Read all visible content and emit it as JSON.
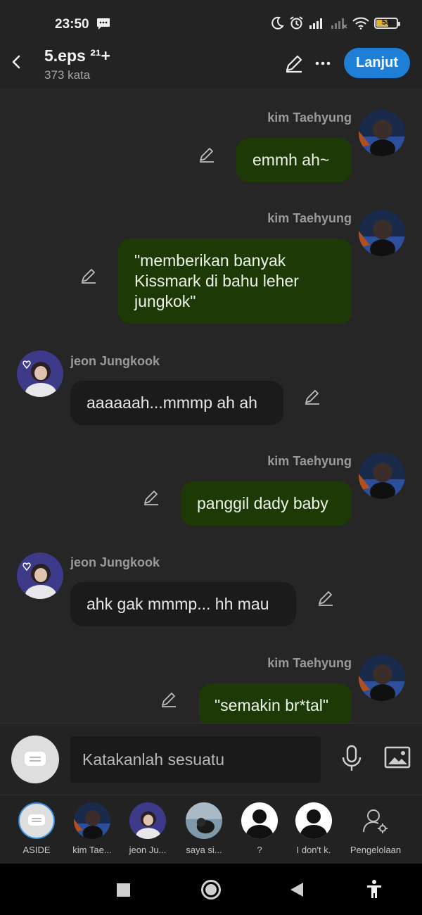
{
  "status_bar": {
    "time": "23:50",
    "battery": "58"
  },
  "header": {
    "title": "5.eps ²¹+",
    "subtitle": "373 kata",
    "continue_label": "Lanjut"
  },
  "messages": [
    {
      "sender": "kim Taehyung",
      "side": "right",
      "text": "emmh ah~"
    },
    {
      "sender": "kim Taehyung",
      "side": "right",
      "text": "\"memberikan banyak Kissmark di bahu leher jungkok\""
    },
    {
      "sender": "jeon Jungkook",
      "side": "left",
      "text": "aaaaaah...mmmp ah ah"
    },
    {
      "sender": "kim Taehyung",
      "side": "right",
      "text": "panggil dady baby"
    },
    {
      "sender": "jeon Jungkook",
      "side": "left",
      "text": "ahk gak mmmp... hh mau"
    },
    {
      "sender": "kim Taehyung",
      "side": "right",
      "text": "\"semakin br*tal\""
    }
  ],
  "composer": {
    "placeholder": "Katakanlah sesuatu"
  },
  "characters": [
    {
      "label": "ASIDE"
    },
    {
      "label": "kim Tae..."
    },
    {
      "label": "jeon Ju..."
    },
    {
      "label": "saya si..."
    },
    {
      "label": "?"
    },
    {
      "label": "I don't k."
    },
    {
      "label": "Pengelolaan"
    }
  ]
}
